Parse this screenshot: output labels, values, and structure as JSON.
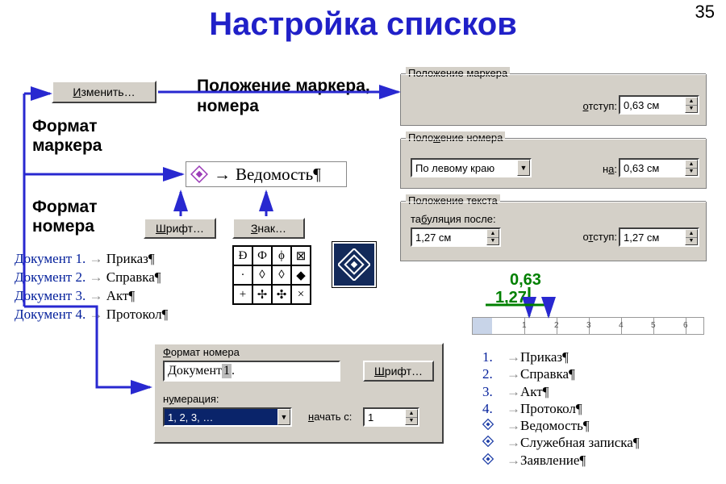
{
  "page_number": "35",
  "title": "Настройка списков",
  "labels": {
    "position": "Положение маркера, номера",
    "marker_format": "Формат маркера",
    "number_format": "Формат номера"
  },
  "buttons": {
    "change": "Изменить…",
    "font": "Шрифт…",
    "symbol": "Знак…",
    "font2": "Шрифт…"
  },
  "sample_line": {
    "arrow": "→",
    "text": "Ведомость¶"
  },
  "groups": {
    "marker_pos": {
      "legend": "Положение маркера",
      "indent_label": "отступ:",
      "indent_value": "0,63 см"
    },
    "number_pos": {
      "legend": "Положение номера",
      "align_value": "По левому краю",
      "at_label": "на:",
      "at_value": "0,63 см"
    },
    "text_pos": {
      "legend": "Положение текста",
      "tab_label": "табуляция после:",
      "tab_value": "1,27 см",
      "indent_label": "отступ:",
      "indent_value": "1,27 см"
    },
    "format_num": {
      "legend": "Формат номера",
      "format_prefix": "Документ ",
      "format_num": "1",
      "format_suffix": ".",
      "numbering_label": "нумерация:",
      "numbering_value": "1, 2, 3, …",
      "start_label": "начать с:",
      "start_value": "1"
    }
  },
  "doc_list": [
    {
      "d": "Документ 1.",
      "t": "Приказ¶"
    },
    {
      "d": "Документ 2.",
      "t": "Справка¶"
    },
    {
      "d": "Документ 3.",
      "t": "Акт¶"
    },
    {
      "d": "Документ 4.",
      "t": "Протокол¶"
    }
  ],
  "charmap": [
    [
      "Ð",
      "Ф",
      "ϕ",
      "⊠"
    ],
    [
      "·",
      "◊",
      "◊",
      "◆"
    ],
    [
      "+",
      "✢",
      "✣",
      "×"
    ]
  ],
  "ruler_numbers": [
    "1",
    "2",
    "3",
    "4",
    "5",
    "6"
  ],
  "annotations": {
    "v063": "0,63",
    "v127": "1,27"
  },
  "preview_numbered": [
    {
      "n": "1.",
      "t": "Приказ¶"
    },
    {
      "n": "2.",
      "t": "Справка¶"
    },
    {
      "n": "3.",
      "t": "Акт¶"
    },
    {
      "n": "4.",
      "t": "Протокол¶"
    }
  ],
  "preview_bulleted": [
    "Ведомость¶",
    "Служебная записка¶",
    "Заявление¶"
  ]
}
